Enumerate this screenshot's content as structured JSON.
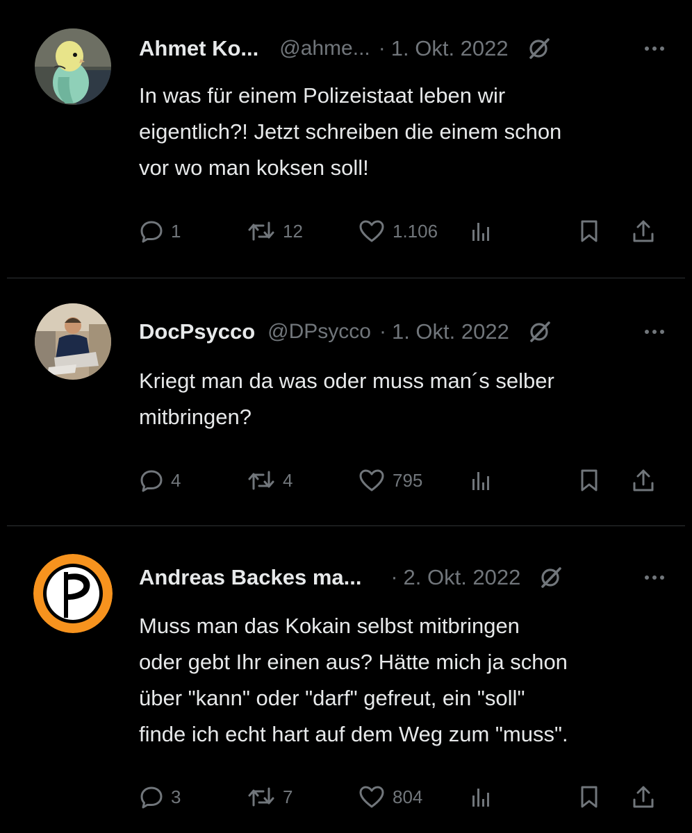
{
  "tweets": [
    {
      "name": "Ahmet Ko...",
      "handle": "@ahme...",
      "separator": "·",
      "date": "1. Okt. 2022",
      "lines": [
        "In was für einem Polizeistaat leben wir",
        "eigentlich?! Jetzt schreiben die einem schon",
        "vor wo man koksen soll!"
      ],
      "replies": "1",
      "retweets": "12",
      "likes": "1.106",
      "avatar": "budgie-photo"
    },
    {
      "name": "DocPsycco",
      "handle": "@DPsycco",
      "separator": "·",
      "date": "1. Okt. 2022",
      "lines": [
        "Kriegt man da was oder muss man´s selber",
        "mitbringen?"
      ],
      "replies": "4",
      "retweets": "4",
      "likes": "795",
      "avatar": "person-photo"
    },
    {
      "name": "Andreas Backes ma...",
      "handle": "",
      "separator": "·",
      "date": "2. Okt. 2022",
      "lines": [
        "Muss man das Kokain selbst mitbringen",
        "oder gebt Ihr einen aus? Hätte mich ja schon",
        "über \"kann\" oder \"darf\" gefreut, ein \"soll\"",
        "finde ich echt hart auf dem Weg zum \"muss\"."
      ],
      "replies": "3",
      "retweets": "7",
      "likes": "804",
      "avatar": "pirate-party-logo"
    }
  ],
  "colors": {
    "background": "#000000",
    "text": "#e7e9ea",
    "secondary": "#71767b",
    "divider": "#2f3336",
    "pirate_orange": "#f7931e"
  }
}
